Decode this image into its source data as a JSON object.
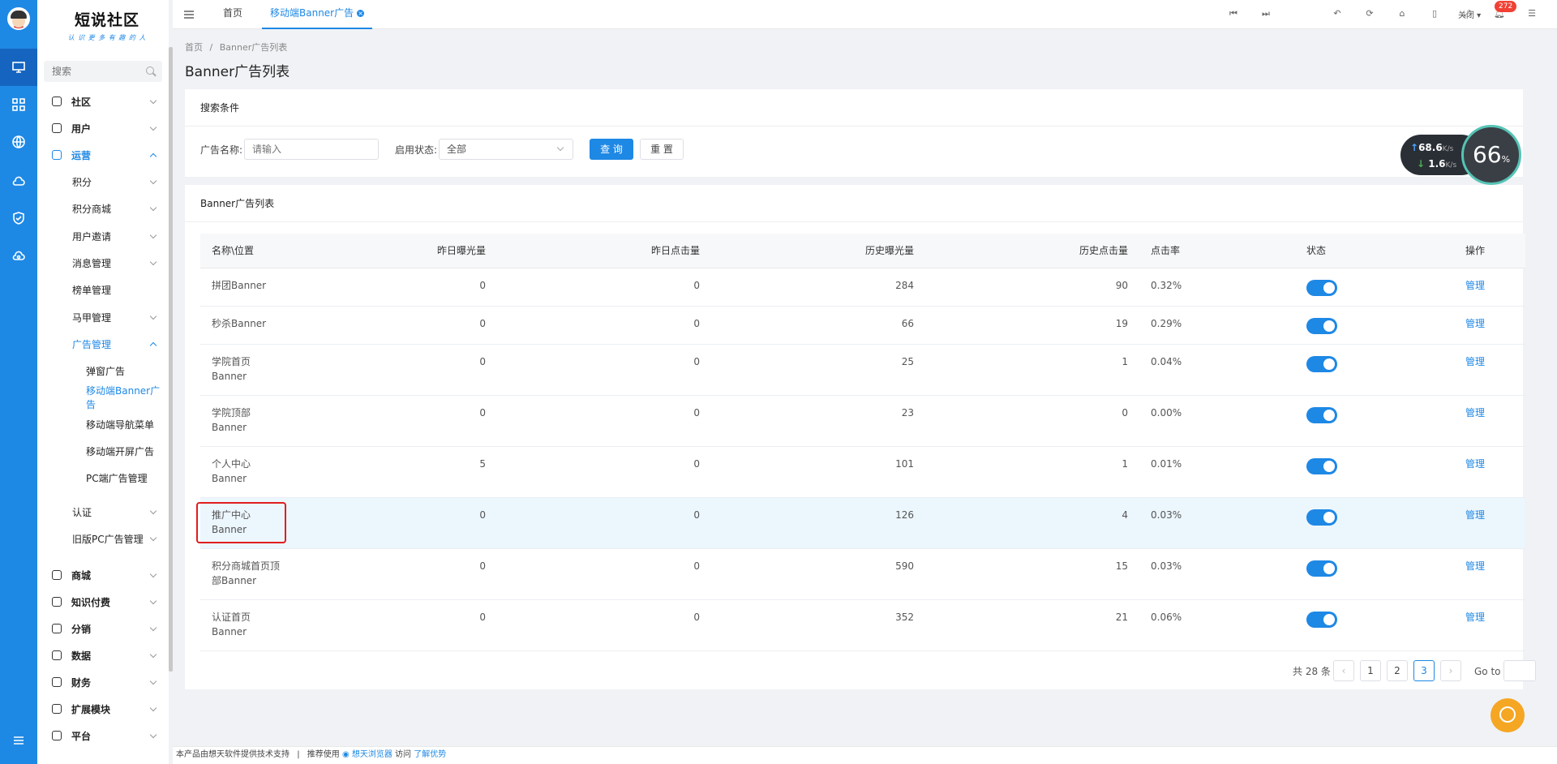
{
  "rail": {
    "items": [
      {
        "icon": "monitor-icon",
        "active": true
      },
      {
        "icon": "grid-icon",
        "active": false
      },
      {
        "icon": "globe-icon",
        "active": false
      },
      {
        "icon": "cloud-icon",
        "active": false
      },
      {
        "icon": "shield-icon",
        "active": false
      },
      {
        "icon": "cloud-sync-icon",
        "active": false
      }
    ],
    "bottom_icon": "menu-icon"
  },
  "logo": {
    "title": "短说社区",
    "slogan": "认 识 更 多 有 趣 的 人"
  },
  "search": {
    "placeholder": "搜索"
  },
  "sidebar": {
    "items": [
      {
        "label": "社区",
        "level": 0,
        "expanded": false
      },
      {
        "label": "用户",
        "level": 0,
        "expanded": false
      },
      {
        "label": "运营",
        "level": 0,
        "expanded": true,
        "active": true
      },
      {
        "label": "积分",
        "level": 1,
        "expanded": false
      },
      {
        "label": "积分商城",
        "level": 1,
        "expanded": false
      },
      {
        "label": "用户邀请",
        "level": 1,
        "expanded": false
      },
      {
        "label": "消息管理",
        "level": 1,
        "expanded": false
      },
      {
        "label": "榜单管理",
        "level": 1,
        "leaf": true
      },
      {
        "label": "马甲管理",
        "level": 1,
        "expanded": false
      },
      {
        "label": "广告管理",
        "level": 1,
        "expanded": true,
        "active": true
      },
      {
        "label": "弹窗广告",
        "level": 2
      },
      {
        "label": "移动端Banner广告",
        "level": 2,
        "current": true
      },
      {
        "label": "移动端导航菜单",
        "level": 2
      },
      {
        "label": "移动端开屏广告",
        "level": 2
      },
      {
        "label": "PC端广告管理",
        "level": 2
      },
      {
        "label": "认证",
        "level": 1,
        "expanded": false
      },
      {
        "label": "旧版PC广告管理",
        "level": 1,
        "expanded": false
      },
      {
        "label": "商城",
        "level": 0,
        "expanded": false
      },
      {
        "label": "知识付费",
        "level": 0,
        "expanded": false
      },
      {
        "label": "分销",
        "level": 0,
        "expanded": false
      },
      {
        "label": "数据",
        "level": 0,
        "expanded": false
      },
      {
        "label": "财务",
        "level": 0,
        "expanded": false
      },
      {
        "label": "扩展模块",
        "level": 0,
        "expanded": false
      },
      {
        "label": "平台",
        "level": 0,
        "expanded": false
      }
    ]
  },
  "tabs": [
    {
      "label": "首页",
      "active": false
    },
    {
      "label": "移动端Banner广告",
      "active": true
    }
  ],
  "toolbar": {
    "close_label": "关闭",
    "notification_count": "272"
  },
  "breadcrumb": {
    "home": "首页",
    "sep": "/",
    "current": "Banner广告列表"
  },
  "page_title": "Banner广告列表",
  "filter": {
    "title": "搜索条件",
    "name_label": "广告名称:",
    "name_placeholder": "请输入",
    "status_label": "启用状态:",
    "status_value": "全部",
    "query_label": "查 询",
    "reset_label": "重 置"
  },
  "list": {
    "title": "Banner广告列表",
    "columns": [
      "名称\\位置",
      "昨日曝光量",
      "昨日点击量",
      "历史曝光量",
      "历史点击量",
      "点击率",
      "状态",
      "操作"
    ],
    "rows": [
      {
        "name1": "拼团Banner",
        "name2": "",
        "yd_exp": "0",
        "yd_click": "0",
        "hist_exp": "284",
        "hist_click": "90",
        "ctr": "0.32%",
        "enabled": true,
        "action": "管理"
      },
      {
        "name1": "秒杀Banner",
        "name2": "",
        "yd_exp": "0",
        "yd_click": "0",
        "hist_exp": "66",
        "hist_click": "19",
        "ctr": "0.29%",
        "enabled": true,
        "action": "管理"
      },
      {
        "name1": "学院首页",
        "name2": "Banner",
        "yd_exp": "0",
        "yd_click": "0",
        "hist_exp": "25",
        "hist_click": "1",
        "ctr": "0.04%",
        "enabled": true,
        "action": "管理"
      },
      {
        "name1": "学院顶部",
        "name2": "Banner",
        "yd_exp": "0",
        "yd_click": "0",
        "hist_exp": "23",
        "hist_click": "0",
        "ctr": "0.00%",
        "enabled": true,
        "action": "管理"
      },
      {
        "name1": "个人中心",
        "name2": "Banner",
        "yd_exp": "5",
        "yd_click": "0",
        "hist_exp": "101",
        "hist_click": "1",
        "ctr": "0.01%",
        "enabled": true,
        "action": "管理"
      },
      {
        "name1": "推广中心",
        "name2": "Banner",
        "yd_exp": "0",
        "yd_click": "0",
        "hist_exp": "126",
        "hist_click": "4",
        "ctr": "0.03%",
        "enabled": true,
        "action": "管理",
        "highlighted": true
      },
      {
        "name1": "积分商城首页顶",
        "name2": "部Banner",
        "yd_exp": "0",
        "yd_click": "0",
        "hist_exp": "590",
        "hist_click": "15",
        "ctr": "0.03%",
        "enabled": true,
        "action": "管理"
      },
      {
        "name1": "认证首页",
        "name2": "Banner",
        "yd_exp": "0",
        "yd_click": "0",
        "hist_exp": "352",
        "hist_click": "21",
        "ctr": "0.06%",
        "enabled": true,
        "action": "管理"
      }
    ]
  },
  "pagination": {
    "total_label": "共 28 条",
    "pages": [
      "1",
      "2",
      "3"
    ],
    "current": "3",
    "goto_label": "Go to"
  },
  "speed": {
    "up": "68.6",
    "down": "1.6",
    "unit": "K/s",
    "percent": "66",
    "percent_unit": "%"
  },
  "footer": {
    "text": "本产品由想天软件提供技术支持",
    "sep": "|",
    "recommend": "推荐使用",
    "browser": "想天浏览器",
    "visit": "访问",
    "learn": "了解优势"
  },
  "colors": {
    "primary": "#1e88e5",
    "highlight_row": "#ecf6fd",
    "annotation_box": "#e01e1e",
    "badge": "#f04134"
  }
}
